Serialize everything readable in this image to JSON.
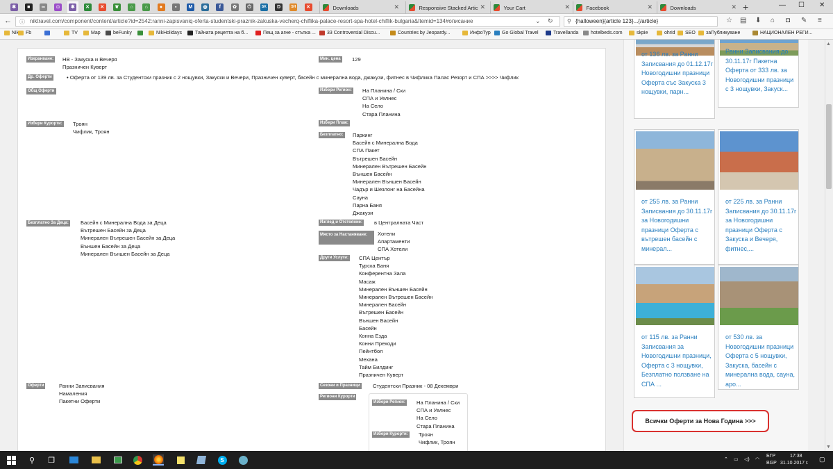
{
  "browser": {
    "pinned_tabs": [
      {
        "icon": "bug-icon",
        "color": "#7b5ea7"
      },
      {
        "icon": "square-logo-icon",
        "color": "#222222"
      },
      {
        "icon": "link-icon",
        "color": "#888888"
      },
      {
        "icon": "pocket-icon",
        "color": "#9b4dc8"
      },
      {
        "icon": "bug-icon",
        "color": "#7b5ea7"
      },
      {
        "icon": "joomla-icon",
        "color": "#2d8a3a"
      },
      {
        "icon": "joomla-icon",
        "color": "#e84b2f"
      },
      {
        "icon": "leaf-icon",
        "color": "#3a8f3a"
      },
      {
        "icon": "home-icon",
        "color": "#4a9a4a"
      },
      {
        "icon": "home-icon",
        "color": "#4a9a4a"
      },
      {
        "icon": "circle-orange-icon",
        "color": "#e27a1f"
      },
      {
        "icon": "gray-square-icon",
        "color": "#777777"
      },
      {
        "icon": "m-icon",
        "color": "#1d5aa8"
      },
      {
        "icon": "globe-icon",
        "color": "#2c6e9b"
      },
      {
        "icon": "facebook-icon",
        "color": "#3b5998"
      },
      {
        "icon": "gear-icon",
        "color": "#777777"
      },
      {
        "icon": "power-icon",
        "color": "#666666"
      },
      {
        "icon": "sk-icon",
        "color": "#1a6fa6"
      },
      {
        "icon": "d-icon",
        "color": "#333333"
      },
      {
        "icon": "sh-icon",
        "color": "#e08a2a"
      },
      {
        "icon": "joomla-icon",
        "color": "#e84b2f"
      }
    ],
    "tabs": [
      {
        "title": "Downloads"
      },
      {
        "title": "Responsive Stacked Artic"
      },
      {
        "title": "Your Cart"
      },
      {
        "title": "Facebook"
      },
      {
        "title": "Downloads"
      }
    ],
    "new_tab": "+",
    "window_controls": {
      "minimize": "—",
      "maximize": "☐",
      "close": "✕"
    },
    "url": "niktravel.com/component/content/article?id=2542:ranni-zapisvaniq-oferta-studentski-praznik-zakuska-vecherq-chiflika-palace-resort-spa-hotel-chiflik-bulgaria&Itemid=134#описание",
    "search": "{halloween}{article 123}...{/article}"
  },
  "bookmarks": [
    {
      "label": "Nik",
      "icon": "folder"
    },
    {
      "label": "Fb",
      "icon": "folder"
    },
    {
      "label": "",
      "icon": "people-icon"
    },
    {
      "label": "TV",
      "icon": "folder"
    },
    {
      "label": "Map",
      "icon": "folder"
    },
    {
      "label": "beFunky",
      "icon": "befunky-icon"
    },
    {
      "label": "",
      "icon": "leaf-icon"
    },
    {
      "label": "NikHolidays",
      "icon": "folder"
    },
    {
      "label": "Тайната рецепта на б...",
      "icon": "b-icon"
    },
    {
      "label": "Пещ за агне - стъпка ...",
      "icon": "youtube-icon"
    },
    {
      "label": "33 Controversial Discu...",
      "icon": "tree-icon"
    },
    {
      "label": "Countries by Jeopardy...",
      "icon": "globe-icon"
    },
    {
      "label": "ИнфоТур",
      "icon": "folder"
    },
    {
      "label": "Go Global Travel",
      "icon": "gg-icon"
    },
    {
      "label": "Travellanda",
      "icon": "flag-icon"
    },
    {
      "label": "hotelbeds.com",
      "icon": "hb-icon"
    },
    {
      "label": "skpie",
      "icon": "folder"
    },
    {
      "label": "ohrid",
      "icon": "folder"
    },
    {
      "label": "SEO",
      "icon": "folder"
    },
    {
      "label": "заПубликуване",
      "icon": "folder"
    },
    {
      "label": "НАЦИОНАЛЕН РЕГИ...",
      "icon": "seal-icon"
    }
  ],
  "left_details": [
    {
      "label": "Изхранване:",
      "values": [
        "НВ - Закуска и Вечеря",
        "Празничен Куверт"
      ]
    },
    {
      "label": "Др. Оферти",
      "values": [
        "• Оферта от 139 лв. за Студентски празник с 2 нощувки, Закуски и Вечери, Празничен куверт, басейн с минерална вода, джакузи, фитнес в Чифлика Палас Резорт и СПА >>>> Чифлик"
      ]
    },
    {
      "label": "Общ Оферти",
      "values": []
    },
    {
      "label": "Избери Курорти:",
      "values": [
        "Троян",
        "Чифлик, Троян"
      ]
    },
    {
      "label": "Безплатно За Деца:",
      "values": [
        "Басейн с Минерална Вода за Деца",
        "Вътрешен Басейн за Деца",
        "Минерален Вътрешен Басейн за Деца",
        "Външен Басейн за Деца",
        "Минерален Външен Басейн за Деца"
      ]
    },
    {
      "label": "Оферти",
      "values": [
        "Ранни Записвания",
        "Намаления",
        "Пакетни Оферти"
      ]
    }
  ],
  "right_details": [
    {
      "label": "Мин. цена",
      "values": [
        "129"
      ]
    },
    {
      "label": "Избери Регион:",
      "values": [
        "На Планина / Ски",
        "СПА и Уелнес",
        "На Село",
        "Стара Планина"
      ]
    },
    {
      "label": "Избери Плаж:",
      "values": []
    },
    {
      "label": "Безплатно:",
      "values": [
        "Паркинг",
        "Басейн с Минерална Вода",
        "СПА Пакет",
        "Вътрешен Басейн",
        "Минерален Вътрешен Басейн",
        "Външен Басейн",
        "Минерален Външен Басейн",
        "Чадър и Шезлонг на Басейна",
        "Сауна",
        "Парна Баня",
        "Джакузи"
      ]
    },
    {
      "label": "Изглед и Отстояние:",
      "values": [
        "в Централната Част"
      ]
    },
    {
      "label": "Място за Настаняване:",
      "values": [
        "Хотели",
        "Апартаменти",
        "СПА Хотели"
      ]
    },
    {
      "label": "Други Услуги:",
      "values": [
        "СПА Център",
        "Турска Баня",
        "Конферентна Зала",
        "Масаж",
        "Минерален Външен Басейн",
        "Минерален Вътрешен Басейн",
        "Минерален Басейн",
        "Вътрешен Басейн",
        "Външен Басейн",
        "Басейн",
        "Конна Езда",
        "Конни Преходи",
        "Пейнтбол",
        "Механа",
        "Тайм Билдинг",
        "Празничен Куверт"
      ]
    },
    {
      "label": "Сезони и Празници",
      "values": [
        "Студентски Празник - 08 Декември"
      ]
    },
    {
      "label": "Региони Курорти",
      "values": []
    }
  ],
  "region_box": [
    {
      "label": "Избери Регион:",
      "values": [
        "На Планина / Ски",
        "СПА и Уелнес",
        "На Село",
        "Стара Планина"
      ]
    },
    {
      "label": "Избери Курорти:",
      "values": [
        "Троян",
        "Чифлик, Троян"
      ]
    }
  ],
  "offers": [
    {
      "text": "от 136 лв. за Ранни Записвания до 01.12.17г Новогодишни празници Оферта със Закуска 3 нощувки, парн..."
    },
    {
      "text": "Ранни Записвания до 30.11.17г Пакетна Оферта от 333 лв. за Новогодишни празници с 3 нощувки, Закуск..."
    },
    {
      "text": "от 255 лв. за Ранни Записвания до 30.11.17г за Новогодишни празници Оферта с вътрешен басейн с минерал..."
    },
    {
      "text": "от 225 лв. за Ранни Записвания до 30.11.17г за Новогодишни празници Оферта с Закуска и Вечеря, фитнес,..."
    },
    {
      "text": "от 115 лв. за Ранни Записвания за Новогодишни празници, Оферта с 3 нощувки, Безплатно ползване на СПА ..."
    },
    {
      "text": "от 530 лв. за Новогодишни празници Оферта с 5 нощувки, Закуска, басейн с минерална вода, сауна, аро..."
    }
  ],
  "all_offers_button": "Всички Оферти за Нова Година >>>",
  "taskbar": {
    "lang_top": "БГР",
    "lang_bottom": "BGP",
    "time": "17:38",
    "date": "31.10.2017 г."
  }
}
